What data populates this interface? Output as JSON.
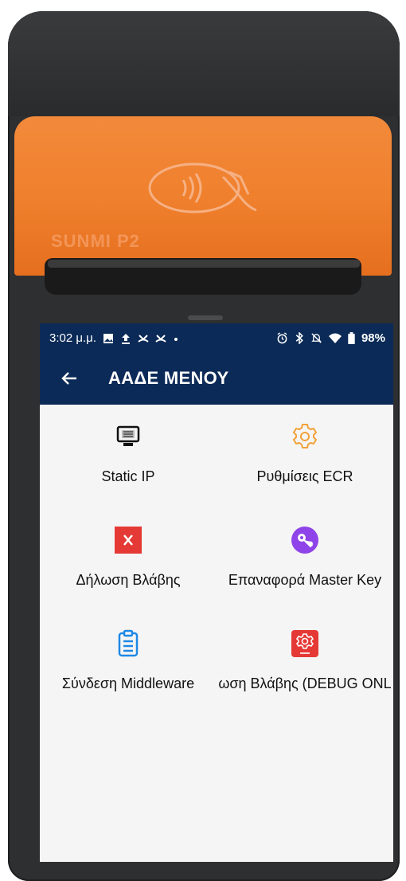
{
  "device": {
    "brand_text": "SUNMI P2"
  },
  "status_bar": {
    "time": "3:02 μ.μ.",
    "battery": "98%",
    "left_icons": [
      "image-icon",
      "upload-icon",
      "missed-call-icon",
      "missed-call-icon",
      "dot-icon"
    ],
    "right_icons": [
      "alarm-icon",
      "bluetooth-icon",
      "mute-icon",
      "wifi-icon",
      "battery-icon"
    ]
  },
  "toolbar": {
    "title": "ΑΑΔΕ ΜΕΝΟΥ",
    "back_icon": "back-arrow-icon"
  },
  "menu": {
    "items": [
      {
        "label": "Static IP",
        "icon": "monitor-icon"
      },
      {
        "label": "Ρυθμίσεις ECR",
        "icon": "settings-gear-icon"
      },
      {
        "label": "Δήλωση Βλάβης",
        "icon": "red-x-icon"
      },
      {
        "label": "Επαναφορά Master Key",
        "icon": "key-icon"
      },
      {
        "label": "Σύνδεση Middleware",
        "icon": "clipboard-icon"
      },
      {
        "label": "ωση Βλάβης (DEBUG ONL",
        "icon": "red-gear-icon"
      }
    ]
  },
  "colors": {
    "toolbar_bg": "#0b2a57",
    "device_orange": "#ef7f2c",
    "gear_orange": "#f2a23a",
    "red": "#e53935",
    "purple": "#8e44e8",
    "blue": "#1e88e5"
  }
}
